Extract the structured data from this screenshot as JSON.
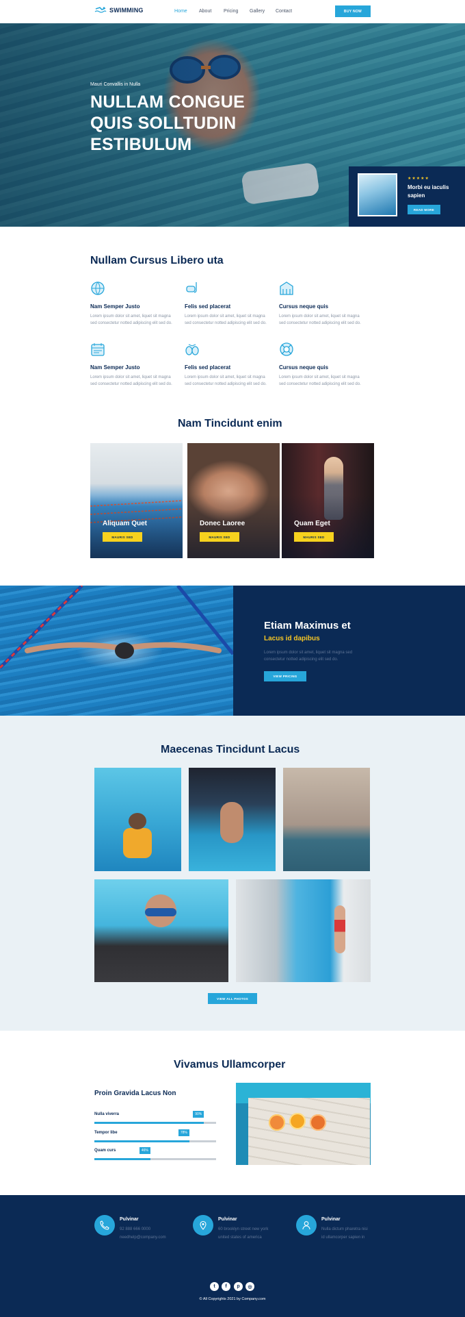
{
  "header": {
    "logo": "SWIMMING",
    "nav": [
      "Home",
      "About",
      "Pricing",
      "Gallery",
      "Contact"
    ],
    "buy_label": "BUY NOW"
  },
  "hero": {
    "subtitle": "Mauri Convallis in Nulla",
    "title": "NULLAM CONGUE QUIS SOLLTUDIN ESTIBULUM",
    "card_stars": "★★★★★",
    "card_title": "Morbi eu iaculis sapien",
    "card_button": "READ MORE"
  },
  "features": {
    "title": "Nullam Cursus Libero uta",
    "items": [
      {
        "title": "Nam Semper Justo",
        "text": "Lorem ipsum dolor sit amet, liquet sit magna sed consectetur notted adipiscing elit sed do.",
        "icon": "globe-icon"
      },
      {
        "title": "Felis sed placerat",
        "text": "Lorem ipsum dolor sit amet, liquet sit magna sed consectetur notted adipiscing elit sed do.",
        "icon": "snorkel-icon"
      },
      {
        "title": "Cursus neque quis",
        "text": "Lorem ipsum dolor sit amet, liquet sit magna sed consectetur notted adipiscing elit sed do.",
        "icon": "building-icon"
      },
      {
        "title": "Nam Semper Justo",
        "text": "Lorem ipsum dolor sit amet, liquet sit magna sed consectetur notted adipiscing elit sed do.",
        "icon": "calendar-icon"
      },
      {
        "title": "Felis sed placerat",
        "text": "Lorem ipsum dolor sit amet, liquet sit magna sed consectetur notted adipiscing elit sed do.",
        "icon": "goggles-icon"
      },
      {
        "title": "Cursus neque quis",
        "text": "Lorem ipsum dolor sit amet, liquet sit magna sed consectetur notted adipiscing elit sed do.",
        "icon": "lifebuoy-icon"
      }
    ]
  },
  "classes": {
    "title": "Nam Tincidunt enim",
    "items": [
      {
        "title": "Aliquam Quet",
        "button": "MAURIS SED"
      },
      {
        "title": "Donec Laoree",
        "button": "MAURIS SED"
      },
      {
        "title": "Quam Eget",
        "button": "MAURIS SED"
      }
    ]
  },
  "promo": {
    "title": "Etiam Maximus et",
    "subtitle": "Lacus id dapibus",
    "text": "Lorem ipsum dolor sit amet, liquet sit magna sed consectetur notted adipiscing elit sed do.",
    "button": "VIEW PRICING"
  },
  "gallery": {
    "title": "Maecenas Tincidunt Lacus",
    "button": "VIEW ALL PHOTOS"
  },
  "skills": {
    "title": "Vivamus Ullamcorper",
    "subtitle": "Proin Gravida Lacus Non",
    "items": [
      {
        "label": "Nulla viverra",
        "pct_text": "90%",
        "value": 0.9
      },
      {
        "label": "Tempor libe",
        "pct_text": "78%",
        "value": 0.78
      },
      {
        "label": "Quam curs",
        "pct_text": "46%",
        "value": 0.46
      }
    ]
  },
  "footer": {
    "contacts": [
      {
        "title": "Pulvinar",
        "line1": "92 888 666 0000",
        "line2": "needhelp@company.com",
        "icon": "phone-icon"
      },
      {
        "title": "Pulvinar",
        "line1": "60 brooklyn street new york",
        "line2": "united states of america",
        "icon": "map-pin-icon"
      },
      {
        "title": "Pulvinar",
        "line1": "Nulla dictum pharetra nisi",
        "line2": "id ullamcorper sapien in",
        "icon": "user-icon"
      }
    ],
    "social": [
      "twitter-icon",
      "facebook-icon",
      "pinterest-icon",
      "instagram-icon"
    ],
    "copyright": "© All Copyrights 2021 by Company.com",
    "colors": {
      "navy": "#0b2a55",
      "accent": "#27a6da",
      "yellow": "#f7d21e"
    }
  }
}
